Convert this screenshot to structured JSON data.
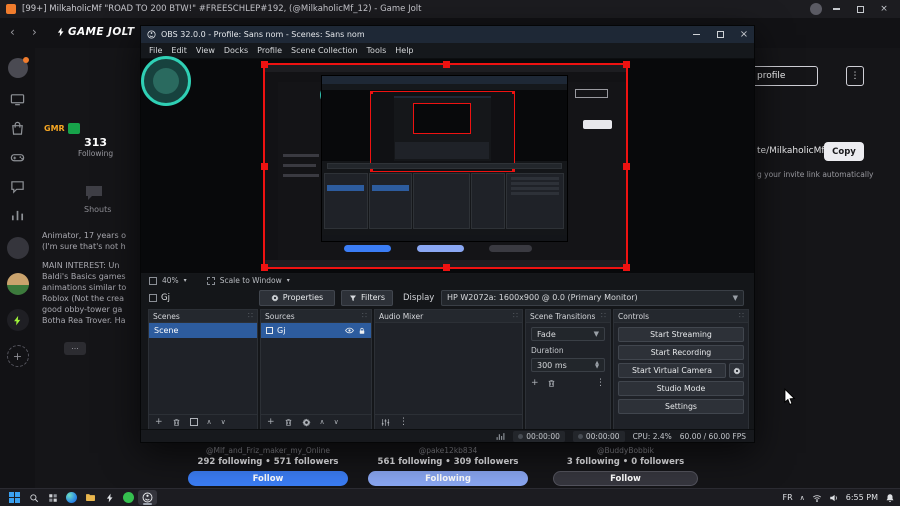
{
  "browser": {
    "tab_title": "[99+] MilkaholicMf \"ROAD TO 200 BTW!\" #FREESCHLEP#192, (@MilkaholicMf_12) - Game Jolt"
  },
  "gamejolt": {
    "logo_text": "GAME JOLT",
    "profile": {
      "badge_gmr": "GMR",
      "following_count": "313",
      "following_label": "Following",
      "shouts_label": "Shouts",
      "bio1_line1": "Animator, 17 years o",
      "bio1_line2": "(I'm sure that's not h",
      "bio2_line1": "MAIN INTEREST: Un",
      "bio2_line2": "Baldi's Basics games",
      "bio2_line3": "animations similar to",
      "bio2_line4": "Roblox (Not the crea",
      "bio2_line5": "good obby-tower ga",
      "bio2_line6": "Botha Rea Trover. Ha",
      "more_button": "..."
    },
    "right_panel": {
      "profile_button": "profile",
      "invite_value": "te/MilkaholicMf_",
      "copy_button": "Copy",
      "invite_hint": "g your invite link automatically"
    },
    "user_cards": [
      {
        "handle": "@Mlf_and_Friz_maker_my_Online",
        "stats": "292 following  •  571 followers",
        "button": "Follow"
      },
      {
        "handle": "@pake12kb834",
        "stats": "561 following  •  309 followers",
        "button": "Following"
      },
      {
        "handle": "@BuddyBobbik",
        "stats": "3 following  •  0 followers",
        "button": "Follow"
      }
    ]
  },
  "obs": {
    "title": "OBS 32.0.0 - Profile: Sans nom - Scenes: Sans nom",
    "menu": [
      "File",
      "Edit",
      "View",
      "Docks",
      "Profile",
      "Scene Collection",
      "Tools",
      "Help"
    ],
    "zoom_value": "40%",
    "scale_mode": "Scale to Window",
    "source_label": "Gj",
    "properties_button": "Properties",
    "filters_button": "Filters",
    "display_label": "Display",
    "display_value": "HP W2072a: 1600x900 @ 0.0 (Primary Monitor)",
    "scenes_title": "Scenes",
    "scene_item": "Scene",
    "sources_title": "Sources",
    "source_item": "Gj",
    "mixer_title": "Audio Mixer",
    "transitions_title": "Scene Transitions",
    "transition_value": "Fade",
    "duration_label": "Duration",
    "duration_value": "300 ms",
    "controls_title": "Controls",
    "btn_stream": "Start Streaming",
    "btn_record": "Start Recording",
    "btn_vcam": "Start Virtual Camera",
    "btn_studio": "Studio Mode",
    "btn_settings": "Settings",
    "status_time1": "00:00:00",
    "status_time2": "00:00:00",
    "status_cpu": "CPU: 2.4%",
    "status_fps": "60.00 / 60.00 FPS"
  },
  "taskbar": {
    "lang": "FR",
    "time": "6:55 PM"
  },
  "colors": {
    "follow_primary": "#3b7df5",
    "follow_secondary": "#8aa7f3",
    "obs_selection": "#2d5c9e",
    "capture_border": "#ee1211",
    "avatar_ring": "#2fd0b5"
  }
}
